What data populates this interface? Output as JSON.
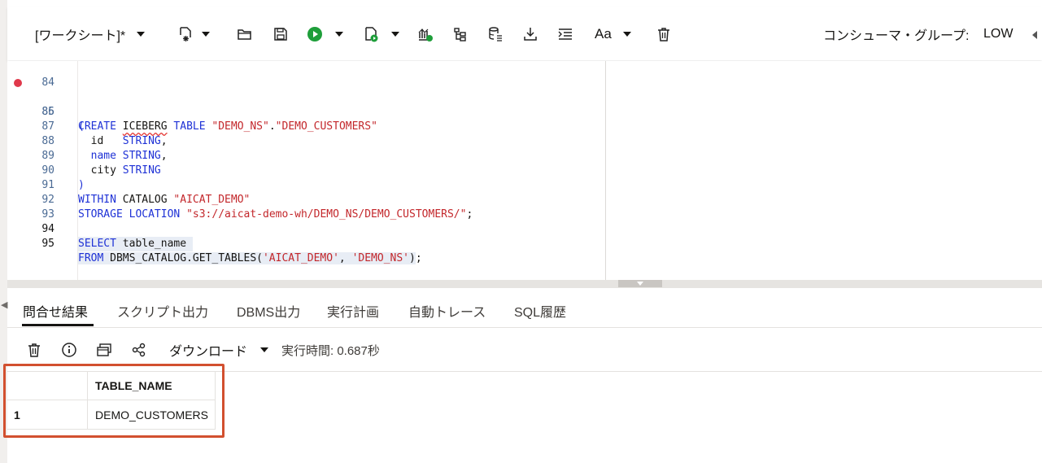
{
  "toolbar": {
    "worksheet_label": "[ワークシート]*",
    "consumer_group_label": "コンシューマ・グループ:",
    "consumer_group_value": "LOW"
  },
  "editor": {
    "lines": [
      {
        "n": "84",
        "code": ""
      },
      {
        "n": "85",
        "code": "CREATE ICEBERG TABLE \"DEMO_NS\".\"DEMO_CUSTOMERS\""
      },
      {
        "n": "86",
        "code": "("
      },
      {
        "n": "87",
        "code": "  id   STRING,"
      },
      {
        "n": "88",
        "code": "  name STRING,"
      },
      {
        "n": "89",
        "code": "  city STRING"
      },
      {
        "n": "90",
        "code": ")"
      },
      {
        "n": "91",
        "code": "WITHIN CATALOG \"AICAT_DEMO\""
      },
      {
        "n": "92",
        "code": "STORAGE LOCATION \"s3://aicat-demo-wh/DEMO_NS/DEMO_CUSTOMERS/\";"
      },
      {
        "n": "93",
        "code": ""
      },
      {
        "n": "94",
        "code": "SELECT table_name"
      },
      {
        "n": "95",
        "code": "FROM DBMS_CATALOG.GET_TABLES('AICAT_DEMO', 'DEMO_NS');"
      }
    ]
  },
  "tabs": [
    "問合せ結果",
    "スクリプト出力",
    "DBMS出力",
    "実行計画",
    "自動トレース",
    "SQL履歴"
  ],
  "results_toolbar": {
    "download_label": "ダウンロード",
    "exec_time": "実行時間: 0.687秒"
  },
  "grid": {
    "columns": [
      "",
      "TABLE_NAME"
    ],
    "rows": [
      [
        "1",
        "DEMO_CUSTOMERS"
      ]
    ]
  },
  "colors": {
    "keyword": "#1f32d6",
    "string": "#c3272b",
    "run_green": "#1e9e3a",
    "highlight_box": "#d2502f",
    "breakpoint": "#e0394b"
  },
  "icons": [
    "new-worksheet-icon",
    "open-folder-icon",
    "save-icon",
    "run-icon",
    "run-script-icon",
    "explain-plan-icon",
    "autotrace-icon",
    "data-load-icon",
    "download-icon",
    "format-icon",
    "font-case-icon",
    "trash-icon",
    "info-icon",
    "single-record-icon",
    "share-icon"
  ]
}
